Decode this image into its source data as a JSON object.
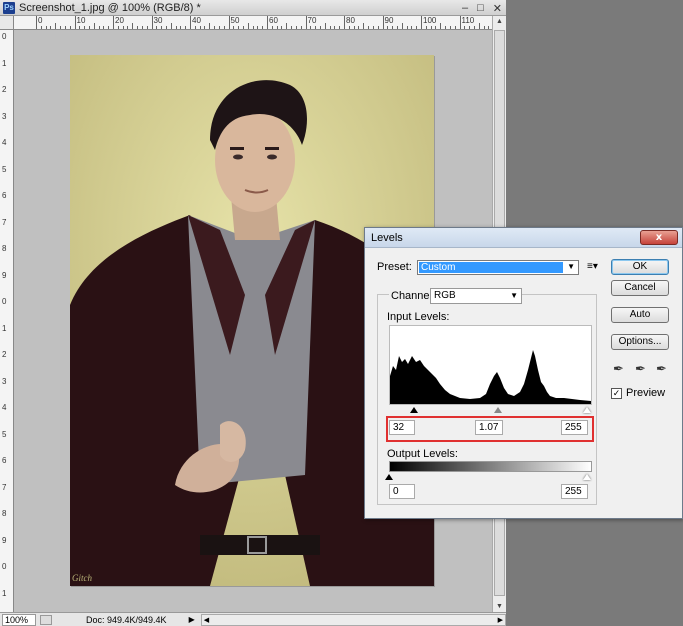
{
  "document": {
    "title": "Screenshot_1.jpg @ 100% (RGB/8) *",
    "app_icon": "Ps",
    "window_buttons": [
      "minimize-icon",
      "maximize-icon",
      "close-icon"
    ],
    "ruler_h": [
      "0",
      "10",
      "20",
      "30",
      "40",
      "50",
      "60",
      "70",
      "80",
      "90",
      "100",
      "110"
    ],
    "ruler_v": [
      "0",
      "1",
      "2",
      "3",
      "4",
      "5",
      "6",
      "7",
      "8",
      "9",
      "0",
      "1",
      "2",
      "3",
      "4",
      "5",
      "6",
      "7",
      "8",
      "9",
      "0",
      "1"
    ],
    "signature": "Gitch"
  },
  "statusbar": {
    "zoom": "100%",
    "doc_info": "Doc: 949.4K/949.4K"
  },
  "levels": {
    "title": "Levels",
    "close": "x",
    "preset_label": "Preset:",
    "preset_value": "Custom",
    "channel_label": "Channel:",
    "channel_value": "RGB",
    "input_levels_label": "Input Levels:",
    "input_black": "32",
    "input_gamma": "1.07",
    "input_white": "255",
    "output_levels_label": "Output Levels:",
    "output_black": "0",
    "output_white": "255",
    "buttons": {
      "ok": "OK",
      "cancel": "Cancel",
      "auto": "Auto",
      "options": "Options..."
    },
    "preview_label": "Preview",
    "preview_checked": true,
    "input_black_level": 32,
    "input_gamma_level": 1.07,
    "input_white_level": 255,
    "colors": {
      "highlight": "#3399ff",
      "redbox": "#e03030",
      "close": "#c6423a"
    }
  }
}
